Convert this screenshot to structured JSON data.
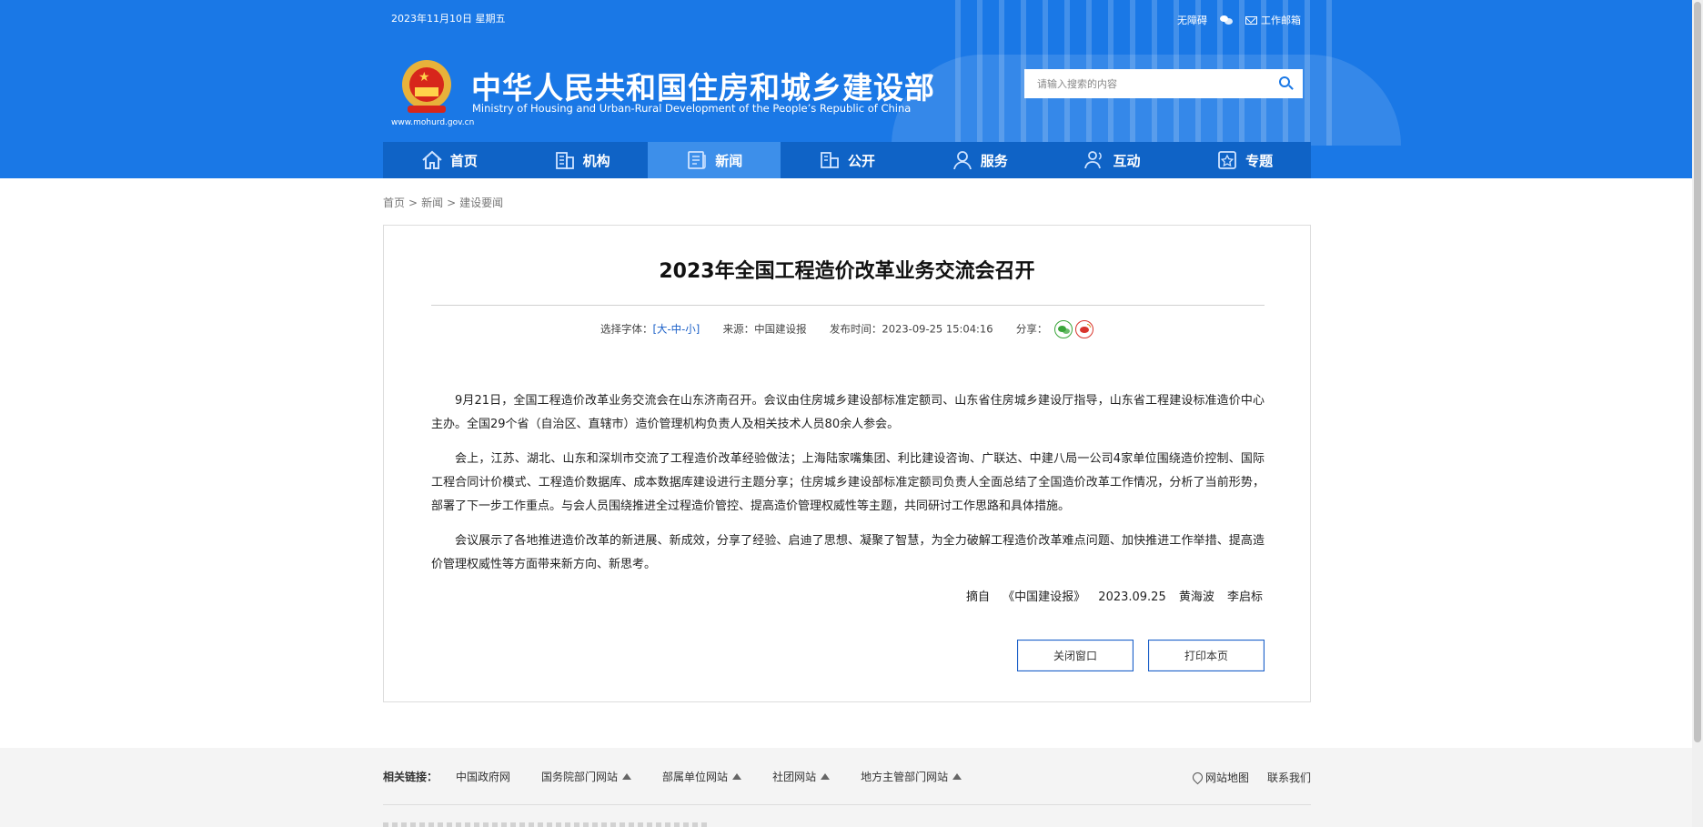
{
  "header": {
    "date": "2023年11月10日 星期五",
    "toplinks": {
      "accessibility": "无障碍",
      "wechat_icon": "wechat-icon",
      "mail_label": "工作邮箱"
    },
    "site_name_cn": "中华人民共和国住房和城乡建设部",
    "site_name_en": "Ministry of Housing and Urban-Rural Development of the People’s Republic of China",
    "site_url": "www.mohurd.gov.cn",
    "search_placeholder": "请输入搜索的内容",
    "brand_color": "#1a78e6"
  },
  "nav": {
    "items": [
      {
        "label": "首页",
        "icon": "home-icon"
      },
      {
        "label": "机构",
        "icon": "building-icon"
      },
      {
        "label": "新闻",
        "icon": "news-icon"
      },
      {
        "label": "公开",
        "icon": "public-info-icon"
      },
      {
        "label": "服务",
        "icon": "service-icon"
      },
      {
        "label": "互动",
        "icon": "interaction-icon"
      },
      {
        "label": "专题",
        "icon": "topic-icon"
      }
    ],
    "active": "新闻"
  },
  "breadcrumb": {
    "home": "首页",
    "news": "新闻",
    "current": "建设要闻",
    "sep": ">"
  },
  "article": {
    "title": "2023年全国工程造价改革业务交流会召开",
    "meta": {
      "font_select_label": "选择字体：",
      "bracket_open": "[",
      "font_large": "大",
      "font_medium": "中",
      "font_small": "小",
      "dash": "-",
      "bracket_close": "]",
      "source": "来源：中国建设报",
      "publish_time": "发布时间：2023-09-25 15:04:16",
      "share_label": "分享："
    },
    "paragraphs": [
      "9月21日，全国工程造价改革业务交流会在山东济南召开。会议由住房城乡建设部标准定额司、山东省住房城乡建设厅指导，山东省工程建设标准造价中心主办。全国29个省（自治区、直辖市）造价管理机构负责人及相关技术人员80余人参会。",
      "会上，江苏、湖北、山东和深圳市交流了工程造价改革经验做法；上海陆家嘴集团、利比建设咨询、广联达、中建八局一公司4家单位围绕造价控制、国际工程合同计价模式、工程造价数据库、成本数据库建设进行主题分享；住房城乡建设部标准定额司负责人全面总结了全国造价改革工作情况，分析了当前形势，部署了下一步工作重点。与会人员围绕推进全过程造价管控、提高造价管理权威性等主题，共同研讨工作思路和具体措施。",
      "会议展示了各地推进造价改革的新进展、新成效，分享了经验、启迪了思想、凝聚了智慧，为全力破解工程造价改革难点问题、加快推进工作举措、提高造价管理权威性等方面带来新方向、新思考。"
    ],
    "byline": "摘自 《中国建设报》 2023.09.25 黄海波 李启标",
    "close_button": "关闭窗口",
    "print_button": "打印本页"
  },
  "footer": {
    "related_label": "相关链接：",
    "links": [
      "中国政府网",
      "国务院部门网站",
      "部属单位网站",
      "社团网站",
      "地方主管部门网站"
    ],
    "sitemap": "网站地图",
    "contact": "联系我们"
  }
}
